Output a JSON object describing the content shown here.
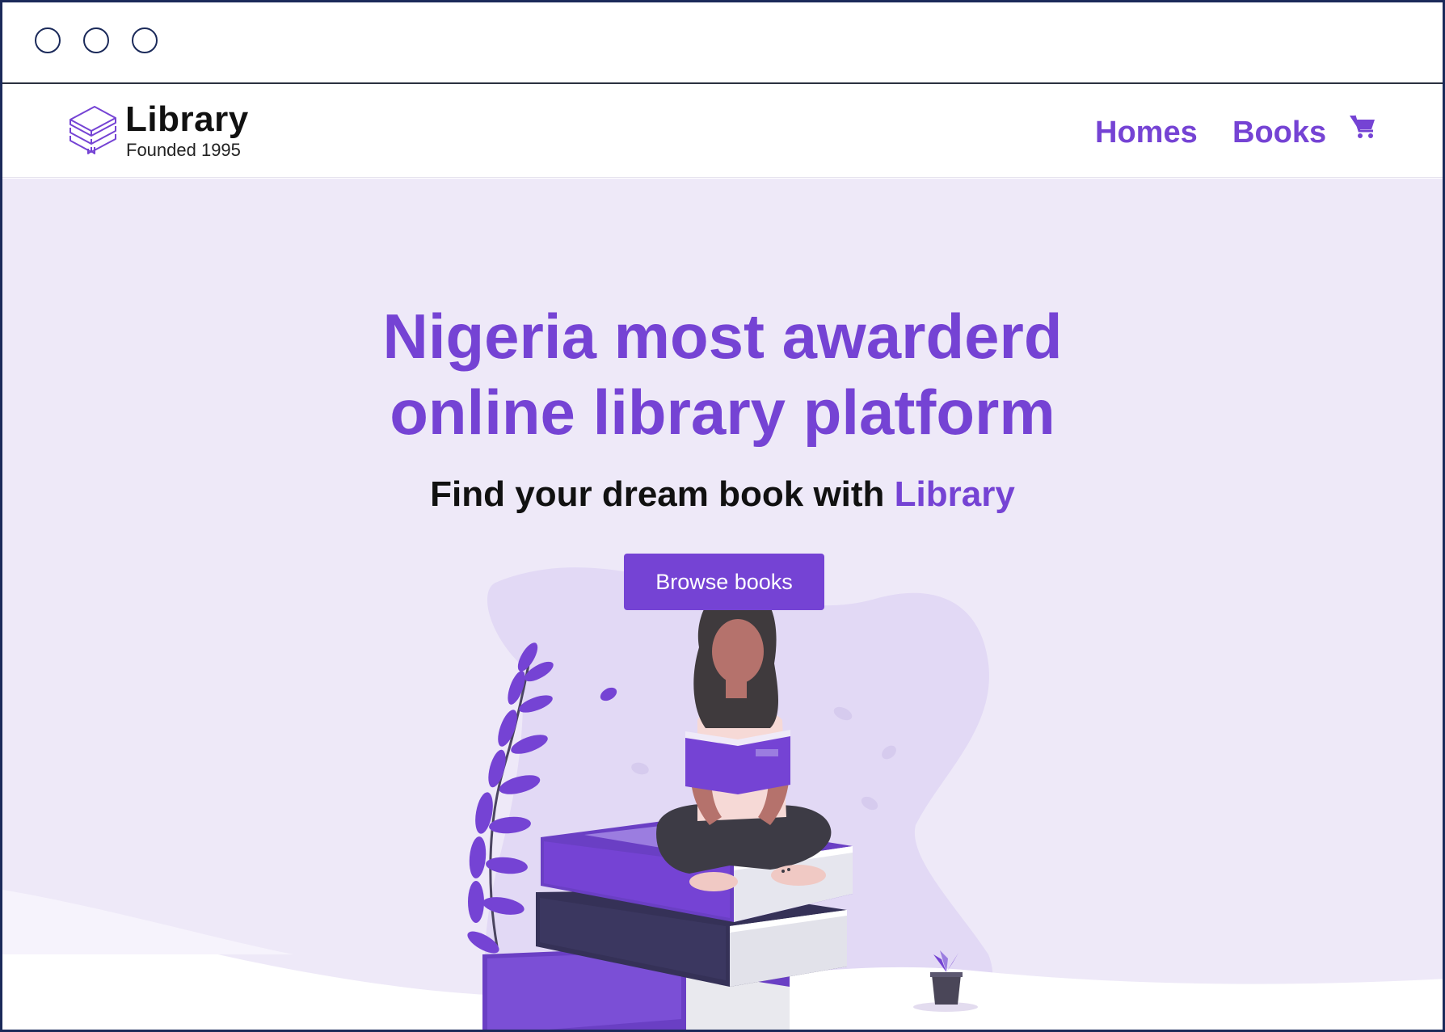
{
  "window": {
    "controls": [
      "window-control",
      "window-control",
      "window-control"
    ]
  },
  "brand": {
    "name": "Library",
    "tagline": "Founded 1995",
    "icon": "stacked-books-logo-icon"
  },
  "nav": {
    "items": [
      {
        "label": "Homes"
      },
      {
        "label": "Books"
      }
    ],
    "cart_icon": "shopping-cart-icon"
  },
  "hero": {
    "title_line1": "Nigeria most awarderd",
    "title_line2": "online library platform",
    "subtitle_prefix": "Find your dream book with ",
    "subtitle_accent": "Library",
    "cta_label": "Browse books",
    "illustration": "woman-reading-on-books-illustration"
  },
  "colors": {
    "accent": "#7543d4",
    "hero_bg": "#eee9f8",
    "text_dark": "#111111",
    "frame_border": "#1b2a5a"
  }
}
